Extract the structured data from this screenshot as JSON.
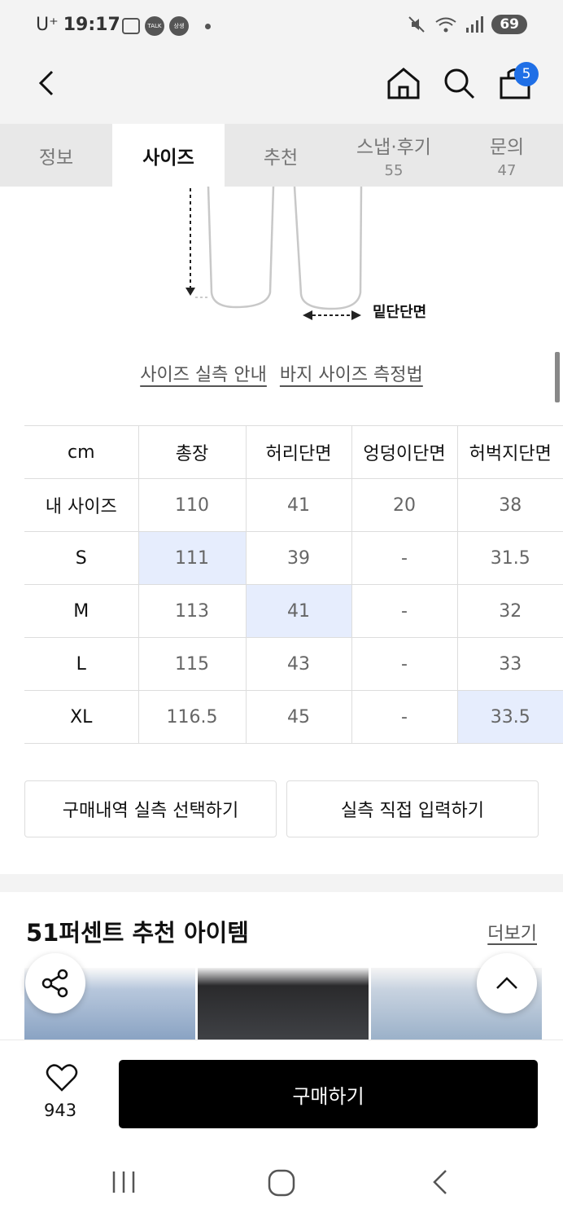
{
  "status_bar": {
    "carrier": "U⁺",
    "time": "19:17",
    "notification_labels": [
      "TALK",
      "상생"
    ],
    "battery": "69"
  },
  "header": {
    "cart_count": "5"
  },
  "tabs": [
    {
      "label": "정보",
      "count": "",
      "active": false
    },
    {
      "label": "사이즈",
      "count": "",
      "active": true
    },
    {
      "label": "추천",
      "count": "",
      "active": false
    },
    {
      "label": "스냅·후기",
      "count": "55",
      "active": false
    },
    {
      "label": "문의",
      "count": "47",
      "active": false
    }
  ],
  "diagram": {
    "hem_label": "밑단단면"
  },
  "links": {
    "size_guide": "사이즈 실측 안내",
    "measure_method": "바지 사이즈 측정법"
  },
  "size_table": {
    "headers": [
      "cm",
      "총장",
      "허리단면",
      "엉덩이단면",
      "허벅지단면"
    ],
    "rows": [
      {
        "label": "내 사이즈",
        "values": [
          "110",
          "41",
          "20",
          "38"
        ]
      },
      {
        "label": "S",
        "values": [
          "111",
          "39",
          "-",
          "31.5"
        ]
      },
      {
        "label": "M",
        "values": [
          "113",
          "41",
          "-",
          "32"
        ]
      },
      {
        "label": "L",
        "values": [
          "115",
          "43",
          "-",
          "33"
        ]
      },
      {
        "label": "XL",
        "values": [
          "116.5",
          "45",
          "-",
          "33.5"
        ]
      }
    ],
    "highlight_color": "#e6edfd"
  },
  "buttons": {
    "purchase_history": "구매내역 실측 선택하기",
    "direct_input": "실측 직접 입력하기"
  },
  "recommend": {
    "title": "51퍼센트 추천 아이템",
    "more": "더보기"
  },
  "bottom": {
    "like_count": "943",
    "buy_label": "구매하기",
    "buy_color": "#000000"
  },
  "colors": {
    "accent_badge": "#1f6fe6"
  }
}
